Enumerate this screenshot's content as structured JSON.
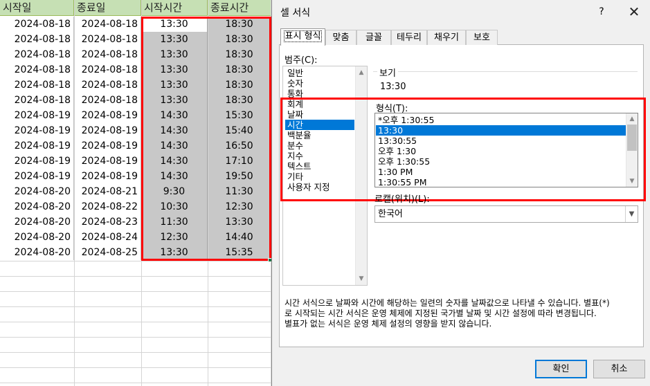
{
  "sheet": {
    "headers": [
      "시작일",
      "종료일",
      "시작시간",
      "종료시간"
    ],
    "rows": [
      [
        "2024-08-18",
        "2024-08-18",
        "13:30",
        "18:30"
      ],
      [
        "2024-08-18",
        "2024-08-18",
        "13:30",
        "18:30"
      ],
      [
        "2024-08-18",
        "2024-08-18",
        "13:30",
        "18:30"
      ],
      [
        "2024-08-18",
        "2024-08-18",
        "13:30",
        "18:30"
      ],
      [
        "2024-08-18",
        "2024-08-18",
        "13:30",
        "18:30"
      ],
      [
        "2024-08-18",
        "2024-08-18",
        "13:30",
        "18:30"
      ],
      [
        "2024-08-19",
        "2024-08-19",
        "14:30",
        "15:30"
      ],
      [
        "2024-08-19",
        "2024-08-19",
        "14:30",
        "15:40"
      ],
      [
        "2024-08-19",
        "2024-08-19",
        "14:30",
        "16:50"
      ],
      [
        "2024-08-19",
        "2024-08-19",
        "14:30",
        "17:10"
      ],
      [
        "2024-08-19",
        "2024-08-19",
        "14:30",
        "19:50"
      ],
      [
        "2024-08-20",
        "2024-08-21",
        "9:30",
        "11:30"
      ],
      [
        "2024-08-20",
        "2024-08-22",
        "10:30",
        "12:30"
      ],
      [
        "2024-08-20",
        "2024-08-23",
        "11:30",
        "13:30"
      ],
      [
        "2024-08-20",
        "2024-08-24",
        "12:30",
        "14:40"
      ],
      [
        "2024-08-20",
        "2024-08-25",
        "13:30",
        "15:35"
      ]
    ],
    "header_color": "#c6e0b4",
    "selection_color": "#c8c8c8",
    "highlight_color": "#ff0000"
  },
  "dialog": {
    "title": "셀 서식",
    "help_label": "?",
    "close_label": "✕",
    "tabs": [
      "표시 형식",
      "맞춤",
      "글꼴",
      "테두리",
      "채우기",
      "보호"
    ],
    "active_tab": "표시 형식",
    "category_label": "범주(C):",
    "categories": [
      "일반",
      "숫자",
      "통화",
      "회계",
      "날짜",
      "시간",
      "백분율",
      "분수",
      "지수",
      "텍스트",
      "기타",
      "사용자 지정"
    ],
    "selected_category": "시간",
    "sample_label": "보기",
    "sample_value": "13:30",
    "type_label": "형식(T):",
    "types": [
      "*오후 1:30:55",
      "13:30",
      "13:30:55",
      "오후 1:30",
      "오후 1:30:55",
      "1:30 PM",
      "1:30:55 PM"
    ],
    "selected_type": "13:30",
    "locale_label": "로캘(위치)(L):",
    "locale_value": "한국어",
    "description": [
      "시간 서식으로 날짜와 시간에 해당하는 일련의 숫자를 날짜값으로 나타낼 수 있습니다. 별표(*)",
      "로 시작되는 시간 서식은 운영 체제에 지정된 국가별 날짜 및 시간 설정에 따라 변경됩니다.",
      "별표가 없는 서식은 운영 체제 설정의 영향을 받지 않습니다."
    ],
    "ok_label": "확인",
    "cancel_label": "취소",
    "accent_color": "#0078d7",
    "icons": {
      "scroll_up": "chevron-up-icon",
      "scroll_down": "chevron-down-icon",
      "dropdown": "chevron-down-icon"
    }
  }
}
